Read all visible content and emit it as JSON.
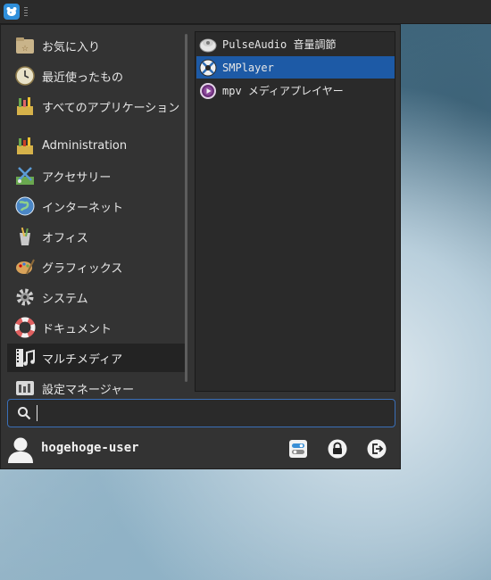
{
  "menu": {
    "categories": [
      {
        "label": "お気に入り",
        "icon": "favorites-folder-icon"
      },
      {
        "label": "最近使ったもの",
        "icon": "recent-clock-icon"
      },
      {
        "label": "すべてのアプリケーション",
        "icon": "all-applications-icon"
      },
      {
        "label": "Administration",
        "icon": "administration-icon"
      },
      {
        "label": "アクセサリー",
        "icon": "accessories-icon"
      },
      {
        "label": "インターネット",
        "icon": "internet-globe-icon"
      },
      {
        "label": "オフィス",
        "icon": "office-icon"
      },
      {
        "label": "グラフィックス",
        "icon": "graphics-palette-icon"
      },
      {
        "label": "システム",
        "icon": "system-gear-icon"
      },
      {
        "label": "ドキュメント",
        "icon": "documentation-lifebuoy-icon"
      },
      {
        "label": "マルチメディア",
        "icon": "multimedia-icon"
      },
      {
        "label": "設定マネージャー",
        "icon": "settings-manager-icon"
      }
    ],
    "selected_category": "マルチメディア",
    "apps": [
      {
        "label": "PulseAudio 音量調節",
        "icon": "pulseaudio-volume-icon"
      },
      {
        "label": "SMPlayer",
        "icon": "smplayer-icon"
      },
      {
        "label": "mpv メディアプレイヤー",
        "icon": "mpv-icon"
      }
    ],
    "selected_app": "SMPlayer"
  },
  "search": {
    "value": "",
    "placeholder": ""
  },
  "footer": {
    "username": "hogehoge-user"
  },
  "colors": {
    "accent": "#1d5aa6",
    "panel": "#333333",
    "search_border": "#3a6fb8"
  }
}
